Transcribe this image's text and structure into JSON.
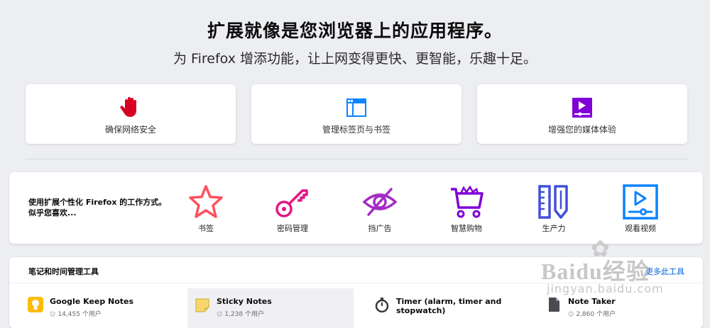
{
  "hero": {
    "title": "扩展就像是您浏览器上的应用程序。",
    "subtitle": "为 Firefox 增添功能，让上网变得更快、更智能，乐趣十足。"
  },
  "features": [
    {
      "label": "确保网络安全",
      "icon": "hand-stop-icon",
      "color": "#d70022"
    },
    {
      "label": "管理标签页与书签",
      "icon": "browser-window-icon",
      "color": "#0a84ff"
    },
    {
      "label": "增强您的媒体体验",
      "icon": "media-play-icon",
      "color": "#8000d7"
    }
  ],
  "categories": {
    "prompt": "使用扩展个性化 Firefox 的工作方式。似乎您喜欢...",
    "items": [
      {
        "label": "书签",
        "icon": "star-icon",
        "color": "#ff4f5e"
      },
      {
        "label": "密码管理",
        "icon": "key-icon",
        "color": "#e31587"
      },
      {
        "label": "挡广告",
        "icon": "eye-slash-icon",
        "color": "#a32cc4"
      },
      {
        "label": "智慧购物",
        "icon": "shopping-cart-icon",
        "color": "#8000d7"
      },
      {
        "label": "生产力",
        "icon": "ruler-pencil-icon",
        "color": "#3f51d8"
      },
      {
        "label": "观看视频",
        "icon": "video-player-icon",
        "color": "#0a84ff"
      }
    ]
  },
  "notes": {
    "title": "笔记和时间管理工具",
    "see_all": "更多此工具",
    "addons": [
      {
        "name": "Google Keep Notes",
        "users": "14,455 个用户",
        "icon": "bulb-icon"
      },
      {
        "name": "Sticky Notes",
        "users": "1,238 个用户",
        "icon": "sticky-note-icon"
      },
      {
        "name": "Timer (alarm, timer and stopwatch)",
        "users": "",
        "icon": "stopwatch-icon"
      },
      {
        "name": "Note Taker",
        "users": "2,860 个用户",
        "icon": "document-icon"
      }
    ]
  },
  "watermark": {
    "brand": "Baidu经验",
    "url": "jingyan.baidu.com"
  }
}
